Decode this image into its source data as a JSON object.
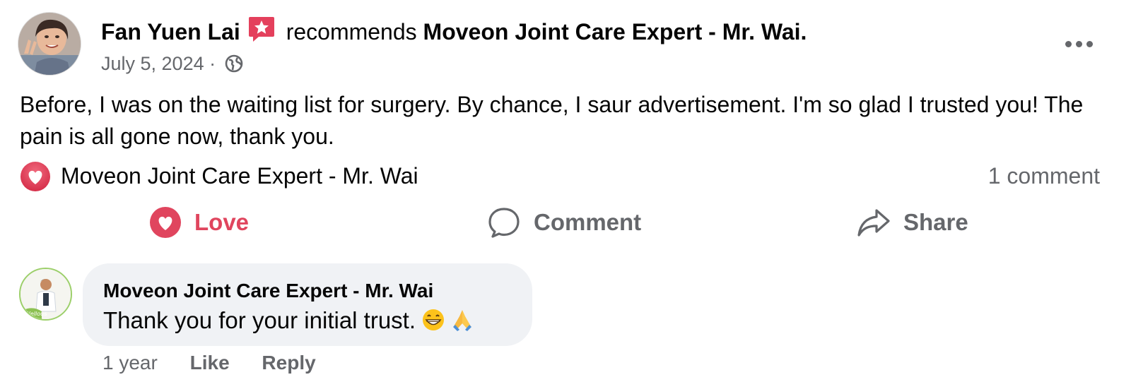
{
  "post": {
    "author": "Fan Yuen Lai",
    "recommends_text": "recommends",
    "page": "Moveon Joint Care Expert - Mr. Wai.",
    "date": "July 5, 2024 ·",
    "body": "Before, I was on the waiting list for surgery. By chance, I saur advertisement. I'm so glad I trusted you! The pain is all gone now, thank you.",
    "reaction_by": "Moveon Joint Care Expert - Mr. Wai",
    "comment_count": "1 comment"
  },
  "actions": {
    "love": "Love",
    "comment": "Comment",
    "share": "Share"
  },
  "comment": {
    "author": "Moveon Joint Care Expert - Mr. Wai",
    "text": "Thank you for your initial trust.",
    "time": "1 year",
    "like": "Like",
    "reply": "Reply"
  },
  "icons": {
    "recommend": "recommend-star-icon",
    "privacy": "globe-icon",
    "more": "more-options-icon",
    "reaction": "love-reaction-icon",
    "love": "heart-icon",
    "comment": "speech-bubble-icon",
    "share": "share-arrow-icon",
    "emoji": [
      "grinning-face-icon",
      "folded-hands-icon"
    ]
  },
  "colors": {
    "love": "#e0455e",
    "secondary_text": "#65676b",
    "bubble": "#f0f2f5",
    "recommend": "#e4405c"
  }
}
